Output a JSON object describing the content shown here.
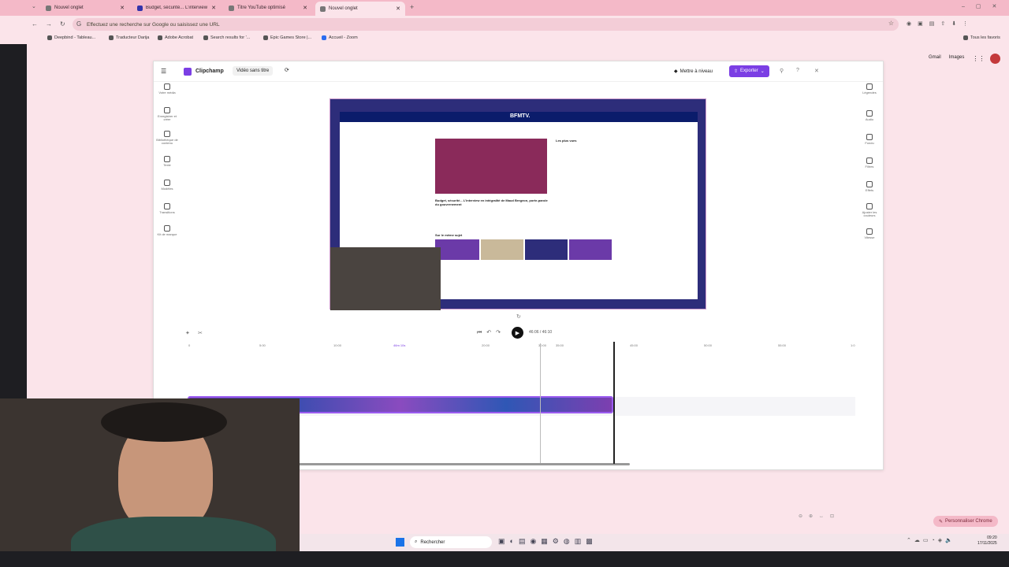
{
  "browser": {
    "tabs": [
      {
        "label": "Nouvel onglet"
      },
      {
        "label": "Budget, sécurité... L'interview e..."
      },
      {
        "label": "Titre YouTube optimisé"
      },
      {
        "label": "Nouvel onglet"
      }
    ],
    "omnibox_text": "Effectuez une recherche sur Google ou saisissez une URL",
    "bookmarks": [
      "Deepbind - Tableau...",
      "Traducteur Darija",
      "Adobe Acrobat",
      "Search results for '...",
      "Epic Games Store |...",
      "Accueil - Zoom"
    ],
    "all_bookmarks": "Tous les favoris",
    "google_links": [
      "Gmail",
      "Images"
    ],
    "customize_chrome": "Personnaliser Chrome"
  },
  "clipchamp": {
    "brand": "Clipchamp",
    "project_title": "Vidéo sans titre",
    "upgrade_label": "Mettre à niveau",
    "export_label": "Exporter",
    "left_sidebar": [
      "Votre média",
      "Enregistrer et créer",
      "Bibliothèque de contenu",
      "Texte",
      "Modèles",
      "Transitions",
      "Kit de marque"
    ],
    "right_sidebar": [
      "Légendes",
      "Audio",
      "Fondu",
      "Filtres",
      "Effets",
      "Ajuster les couleurs",
      "Vitesse"
    ],
    "time_display": "46:06 / 46:10",
    "ruler_ticks": [
      "0",
      "5:00",
      "10:00",
      "15:00",
      "20:00",
      "25:00",
      "30:00",
      "35:00",
      "40:00",
      "45:00",
      "50:00",
      "55:00",
      "1:0"
    ],
    "ruler_marker": "46m 10s",
    "preview": {
      "site": "BFMTV.",
      "headline": "Budget, sécurité... L'interview en intégralité de Maud Bregeon, porte-parole du gouvernement",
      "side_title": "Les plus vues",
      "related_title": "Sur le même sujet"
    }
  },
  "taskbar": {
    "search_label": "Rechercher",
    "time": "09:20",
    "date": "17/11/2025"
  },
  "colors": {
    "accent": "#7b3fe4",
    "browser_tabbar": "#f4b9c8",
    "page_bg": "#fbe4ea"
  }
}
